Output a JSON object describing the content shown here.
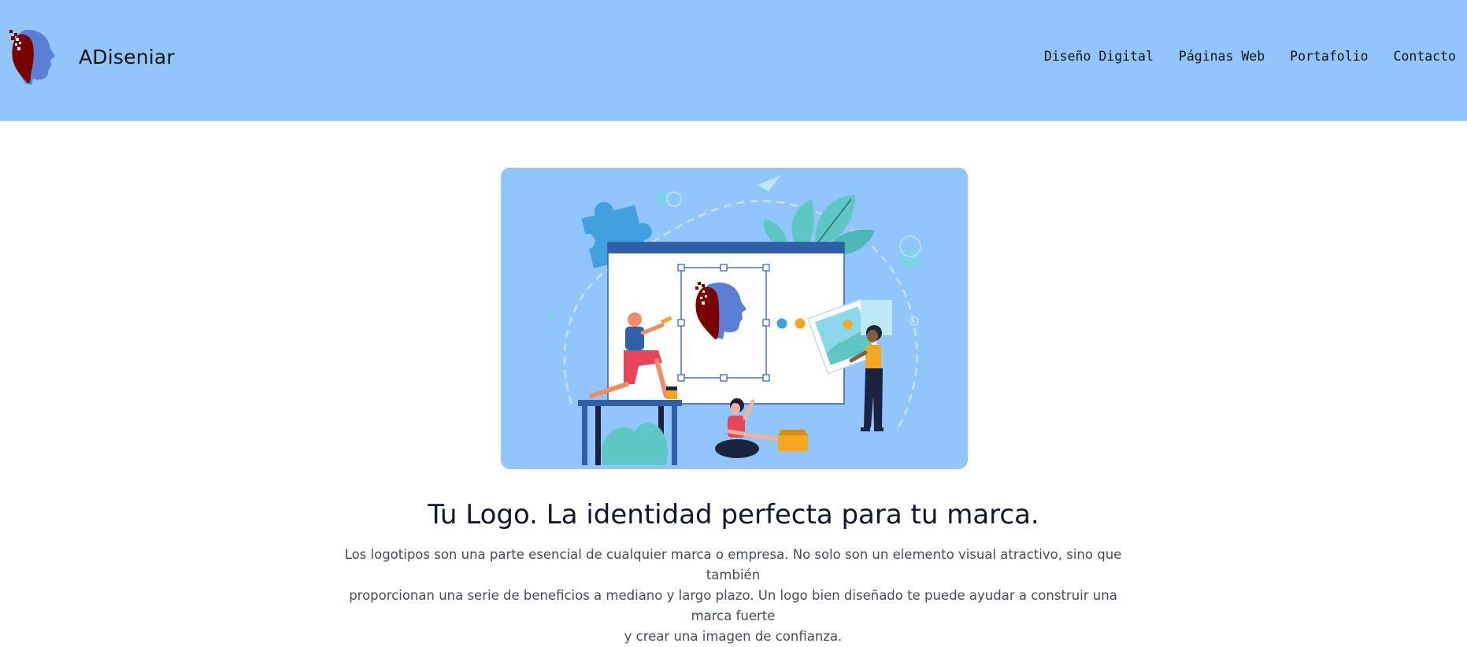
{
  "brand": {
    "name": "ADiseniar",
    "logo_icon": "head-profile-logo-icon"
  },
  "nav": {
    "items": [
      {
        "label": "Diseño Digital"
      },
      {
        "label": "Páginas Web"
      },
      {
        "label": "Portafolio"
      },
      {
        "label": "Contacto"
      }
    ]
  },
  "hero": {
    "illustration": "logo-design-team-illustration",
    "title": "Tu Logo. La identidad perfecta para tu marca.",
    "description_lines": [
      "Los logotipos son una parte esencial de cualquier marca o empresa. No solo son un elemento visual atractivo, sino que también",
      "proporcionan una serie de beneficios a mediano y largo plazo. Un logo bien diseñado te puede ayudar a construir una marca fuerte",
      "y crear una imagen de confianza."
    ]
  },
  "colors": {
    "header_bg": "#92c5fb",
    "logo_dark_red": "#7a0000",
    "logo_blue": "#5b7fd6",
    "accent_teal": "#5ec7c4",
    "accent_orange": "#f5a623",
    "accent_red": "#e8455b"
  }
}
